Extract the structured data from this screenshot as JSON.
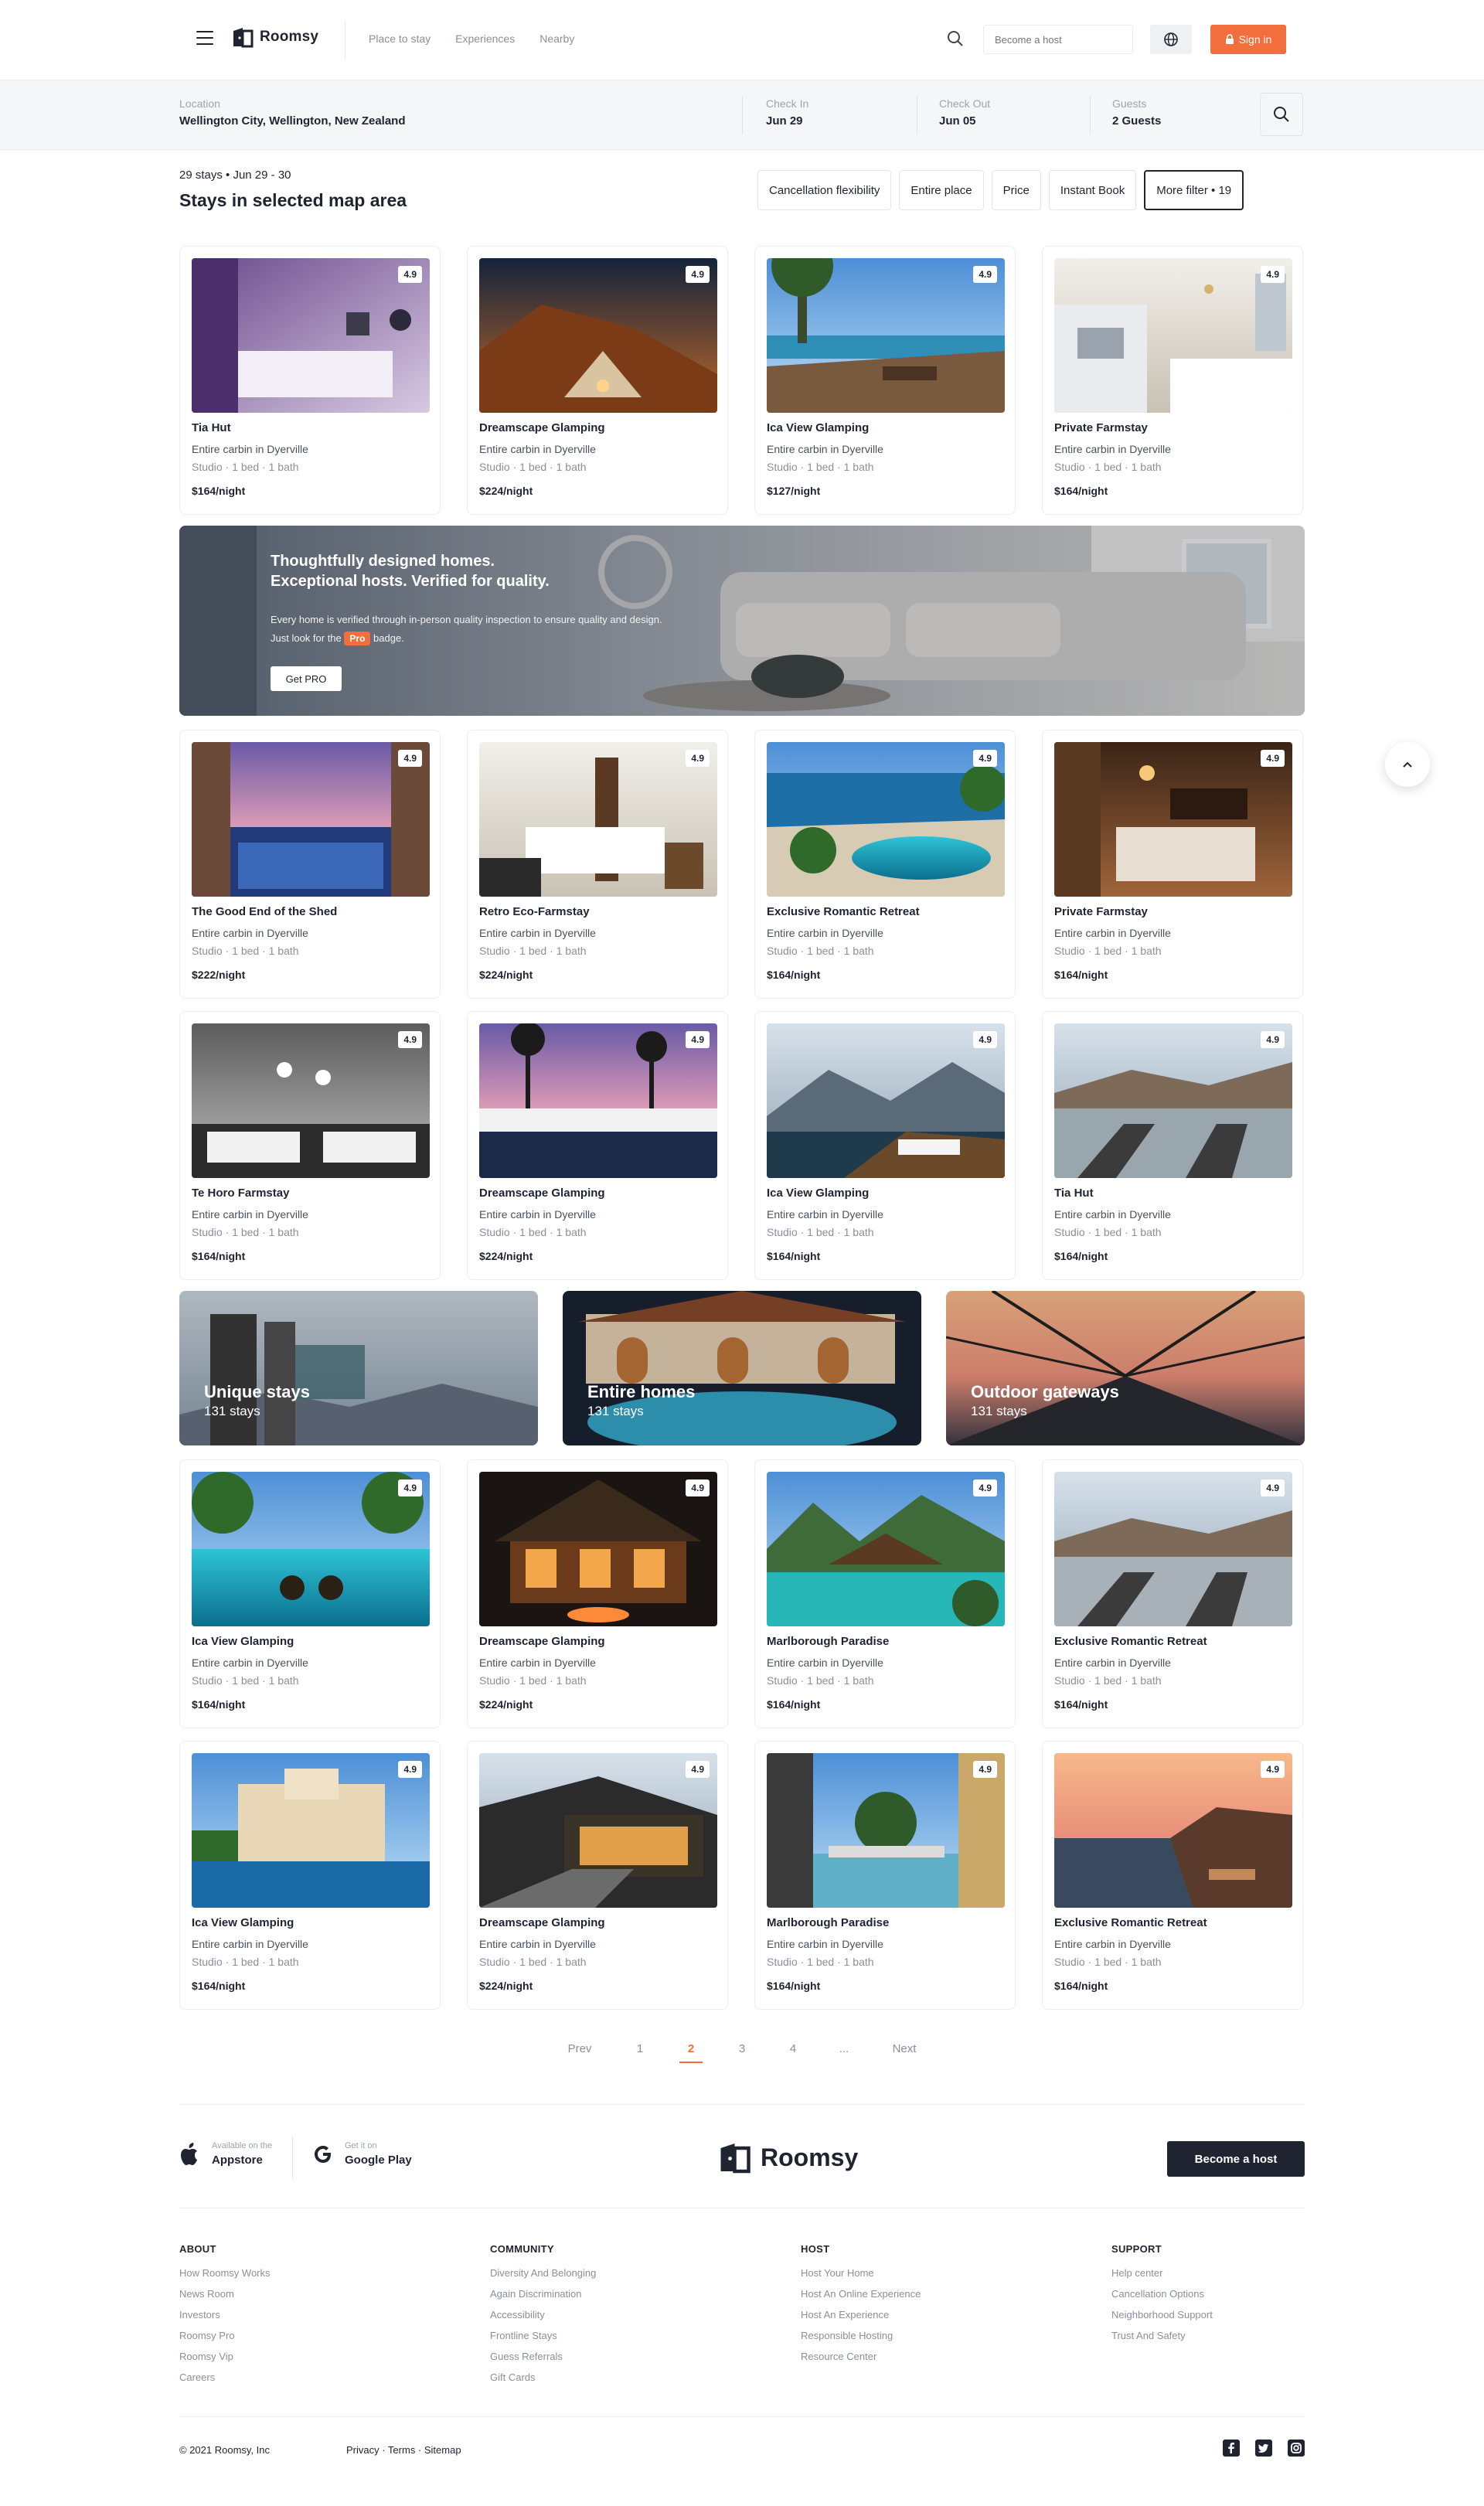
{
  "header": {
    "brand": "Roomsy",
    "nav": [
      "Place to stay",
      "Experiences",
      "Nearby"
    ],
    "host_placeholder": "Become a host",
    "signin_label": "Sign in"
  },
  "search": {
    "location_label": "Location",
    "location_value": "Wellington City, Wellington, New Zealand",
    "checkin_label": "Check In",
    "checkin_value": "Jun 29",
    "checkout_label": "Check Out",
    "checkout_value": "Jun 05",
    "guests_label": "Guests",
    "guests_value": "2 Guests"
  },
  "results": {
    "meta": "29 stays • Jun 29 - 30",
    "title": "Stays in selected map area",
    "filters": [
      "Cancellation flexibility",
      "Entire place",
      "Price",
      "Instant Book"
    ],
    "more_filter": "More filter • 19"
  },
  "cards": [
    {
      "title": "Tia Hut",
      "subtitle": "Entire carbin in Dyerville",
      "details": "Studio · 1 bed · 1 bath",
      "price": "$164/night",
      "rating": "4.9"
    },
    {
      "title": "Dreamscape Glamping",
      "subtitle": "Entire carbin in Dyerville",
      "details": "Studio · 1 bed · 1 bath",
      "price": "$224/night",
      "rating": "4.9"
    },
    {
      "title": "Ica View Glamping",
      "subtitle": "Entire carbin in Dyerville",
      "details": "Studio · 1 bed · 1 bath",
      "price": "$127/night",
      "rating": "4.9"
    },
    {
      "title": "Private Farmstay",
      "subtitle": "Entire carbin in Dyerville",
      "details": "Studio · 1 bed · 1 bath",
      "price": "$164/night",
      "rating": "4.9"
    },
    {
      "title": "The Good End of the Shed",
      "subtitle": "Entire carbin in Dyerville",
      "details": "Studio · 1 bed · 1 bath",
      "price": "$222/night",
      "rating": "4.9"
    },
    {
      "title": "Retro Eco-Farmstay",
      "subtitle": "Entire carbin in Dyerville",
      "details": "Studio · 1 bed · 1 bath",
      "price": "$224/night",
      "rating": "4.9"
    },
    {
      "title": "Exclusive Romantic Retreat",
      "subtitle": "Entire carbin in Dyerville",
      "details": "Studio · 1 bed · 1 bath",
      "price": "$164/night",
      "rating": "4.9"
    },
    {
      "title": "Private Farmstay",
      "subtitle": "Entire carbin in Dyerville",
      "details": "Studio · 1 bed · 1 bath",
      "price": "$164/night",
      "rating": "4.9"
    },
    {
      "title": "Te Horo Farmstay",
      "subtitle": "Entire carbin in Dyerville",
      "details": "Studio · 1 bed · 1 bath",
      "price": "$164/night",
      "rating": "4.9"
    },
    {
      "title": "Dreamscape Glamping",
      "subtitle": "Entire carbin in Dyerville",
      "details": "Studio · 1 bed · 1 bath",
      "price": "$224/night",
      "rating": "4.9"
    },
    {
      "title": "Ica View Glamping",
      "subtitle": "Entire carbin in Dyerville",
      "details": "Studio · 1 bed · 1 bath",
      "price": "$164/night",
      "rating": "4.9"
    },
    {
      "title": "Tia Hut",
      "subtitle": "Entire carbin in Dyerville",
      "details": "Studio · 1 bed · 1 bath",
      "price": "$164/night",
      "rating": "4.9"
    },
    {
      "title": "Ica View Glamping",
      "subtitle": "Entire carbin in Dyerville",
      "details": "Studio · 1 bed · 1 bath",
      "price": "$164/night",
      "rating": "4.9"
    },
    {
      "title": "Dreamscape Glamping",
      "subtitle": "Entire carbin in Dyerville",
      "details": "Studio · 1 bed · 1 bath",
      "price": "$224/night",
      "rating": "4.9"
    },
    {
      "title": "Marlborough Paradise",
      "subtitle": "Entire carbin in Dyerville",
      "details": "Studio · 1 bed · 1 bath",
      "price": "$164/night",
      "rating": "4.9"
    },
    {
      "title": "Exclusive Romantic Retreat",
      "subtitle": "Entire carbin in Dyerville",
      "details": "Studio · 1 bed · 1 bath",
      "price": "$164/night",
      "rating": "4.9"
    },
    {
      "title": "Ica View Glamping",
      "subtitle": "Entire carbin in Dyerville",
      "details": "Studio · 1 bed · 1 bath",
      "price": "$164/night",
      "rating": "4.9"
    },
    {
      "title": "Dreamscape Glamping",
      "subtitle": "Entire carbin in Dyerville",
      "details": "Studio · 1 bed · 1 bath",
      "price": "$224/night",
      "rating": "4.9"
    },
    {
      "title": "Marlborough Paradise",
      "subtitle": "Entire carbin in Dyerville",
      "details": "Studio · 1 bed · 1 bath",
      "price": "$164/night",
      "rating": "4.9"
    },
    {
      "title": "Exclusive Romantic Retreat",
      "subtitle": "Entire carbin in Dyerville",
      "details": "Studio · 1 bed · 1 bath",
      "price": "$164/night",
      "rating": "4.9"
    }
  ],
  "promo": {
    "heading_line1": "Thoughtfully designed homes.",
    "heading_line2": "Exceptional hosts. Verified for quality.",
    "text_line1": "Every home is verified through in-person quality inspection to ensure quality and design.",
    "text_pre": "Just look for the",
    "badge": "Pro",
    "text_post": "badge.",
    "button": "Get PRO"
  },
  "categories": [
    {
      "title": "Unique stays",
      "count": "131 stays"
    },
    {
      "title": "Entire homes",
      "count": "131 stays"
    },
    {
      "title": "Outdoor gateways",
      "count": "131 stays"
    }
  ],
  "pagination": {
    "prev": "Prev",
    "pages": [
      "1",
      "2",
      "3",
      "4",
      "..."
    ],
    "next": "Next",
    "active": "2"
  },
  "footer": {
    "appstore_small": "Available on the",
    "appstore_big": "Appstore",
    "googleplay_small": "Get it on",
    "googleplay_big": "Google Play",
    "brand": "Roomsy",
    "become_host": "Become a host",
    "columns": [
      {
        "heading": "ABOUT",
        "links": [
          "How Roomsy Works",
          "News Room",
          "Investors",
          "Roomsy Pro",
          "Roomsy Vip",
          "Careers"
        ]
      },
      {
        "heading": "COMMUNITY",
        "links": [
          "Diversity And Belonging",
          "Again Discrimination",
          "Accessibility",
          "Frontline Stays",
          "Guess Referrals",
          "Gift Cards"
        ]
      },
      {
        "heading": "HOST",
        "links": [
          "Host Your Home",
          "Host An Online Experience",
          "Host An Experience",
          "Responsible Hosting",
          "Resource Center"
        ]
      },
      {
        "heading": "SUPPORT",
        "links": [
          "Help center",
          "Cancellation Options",
          "Neighborhood Support",
          "Trust And Safety"
        ]
      }
    ],
    "copyright": "© 2021 Roomsy, Inc",
    "legal": "Privacy · Terms · Sitemap",
    "social_icons": [
      "facebook-icon",
      "twitter-icon",
      "instagram-icon"
    ]
  },
  "colors": {
    "accent": "#f26e3d",
    "dark": "#1f2430",
    "muted": "#8a8f99"
  }
}
